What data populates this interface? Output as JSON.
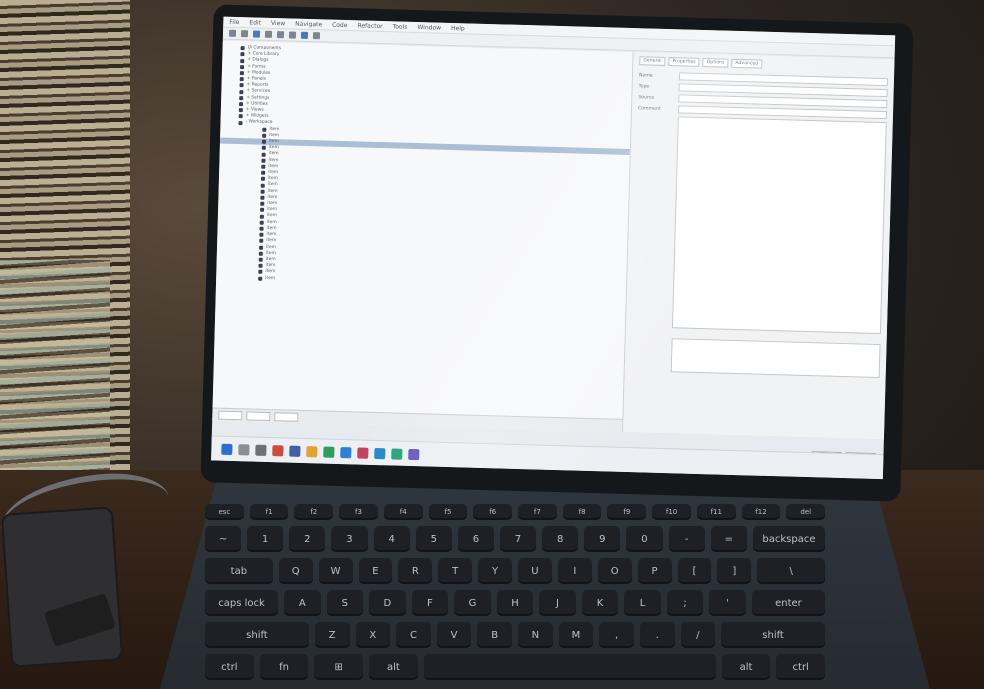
{
  "scene": {
    "description_free": true,
    "colors": {
      "lid": "#15181b",
      "screen": "#e7eaee",
      "desk": "#3b2a1e",
      "selection": "#a9bfd6"
    }
  },
  "app": {
    "menu": [
      "File",
      "Edit",
      "View",
      "Navigate",
      "Code",
      "Refactor",
      "Tools",
      "Window",
      "Help"
    ],
    "tree": {
      "rows": [
        {
          "text": "Ui Components",
          "indent": 0
        },
        {
          "text": "+ Core Library",
          "indent": 0
        },
        {
          "text": "+ Dialogs",
          "indent": 0
        },
        {
          "text": "+ Forms",
          "indent": 0
        },
        {
          "text": "+ Modules",
          "indent": 0
        },
        {
          "text": "+ Panels",
          "indent": 0
        },
        {
          "text": "+ Reports",
          "indent": 0
        },
        {
          "text": "+ Services",
          "indent": 0
        },
        {
          "text": "+ Settings",
          "indent": 0
        },
        {
          "text": "+ Utilities",
          "indent": 0
        },
        {
          "text": "+ Views",
          "indent": 0
        },
        {
          "text": "+ Widgets",
          "indent": 0
        },
        {
          "text": "- Workspace",
          "indent": 0
        },
        {
          "text": "item",
          "indent": 1
        },
        {
          "text": "item",
          "indent": 1
        },
        {
          "text": "item",
          "indent": 1,
          "selected": true
        },
        {
          "text": "item",
          "indent": 1
        },
        {
          "text": "item",
          "indent": 1
        },
        {
          "text": "item",
          "indent": 1
        },
        {
          "text": "item",
          "indent": 1
        },
        {
          "text": "item",
          "indent": 1
        },
        {
          "text": "item",
          "indent": 1
        },
        {
          "text": "item",
          "indent": 1
        },
        {
          "text": "item",
          "indent": 1
        },
        {
          "text": "item",
          "indent": 1
        },
        {
          "text": "item",
          "indent": 1
        },
        {
          "text": "item",
          "indent": 1
        },
        {
          "text": "item",
          "indent": 1
        },
        {
          "text": "item",
          "indent": 1
        },
        {
          "text": "item",
          "indent": 1
        },
        {
          "text": "item",
          "indent": 1
        },
        {
          "text": "item",
          "indent": 1
        },
        {
          "text": "item",
          "indent": 1
        },
        {
          "text": "item",
          "indent": 1
        },
        {
          "text": "item",
          "indent": 1
        },
        {
          "text": "item",
          "indent": 1
        },
        {
          "text": "item",
          "indent": 1
        },
        {
          "text": "item",
          "indent": 1
        }
      ]
    },
    "detail": {
      "tabs": [
        "General",
        "Properties",
        "Options",
        "Advanced"
      ],
      "fields": [
        {
          "label": "Name",
          "value": ""
        },
        {
          "label": "Type",
          "value": ""
        },
        {
          "label": "Source",
          "value": ""
        },
        {
          "label": "Comment",
          "value": ""
        }
      ]
    },
    "dialog_buttons": [
      "OK",
      "Cancel"
    ]
  },
  "keyboard": {
    "row1": [
      "esc",
      "f1",
      "f2",
      "f3",
      "f4",
      "f5",
      "f6",
      "f7",
      "f8",
      "f9",
      "f10",
      "f11",
      "f12",
      "del"
    ],
    "row2": [
      "~",
      "1",
      "2",
      "3",
      "4",
      "5",
      "6",
      "7",
      "8",
      "9",
      "0",
      "-",
      "=",
      "backspace"
    ],
    "row3": [
      "tab",
      "Q",
      "W",
      "E",
      "R",
      "T",
      "Y",
      "U",
      "I",
      "O",
      "P",
      "[",
      "]",
      "\\"
    ],
    "row4": [
      "caps lock",
      "A",
      "S",
      "D",
      "F",
      "G",
      "H",
      "J",
      "K",
      "L",
      ";",
      "'",
      "enter"
    ],
    "row5": [
      "shift",
      "Z",
      "X",
      "C",
      "V",
      "B",
      "N",
      "M",
      ",",
      ".",
      "/",
      "shift"
    ],
    "row6": [
      "ctrl",
      "fn",
      "⊞",
      "alt",
      "",
      "alt",
      "ctrl"
    ]
  }
}
